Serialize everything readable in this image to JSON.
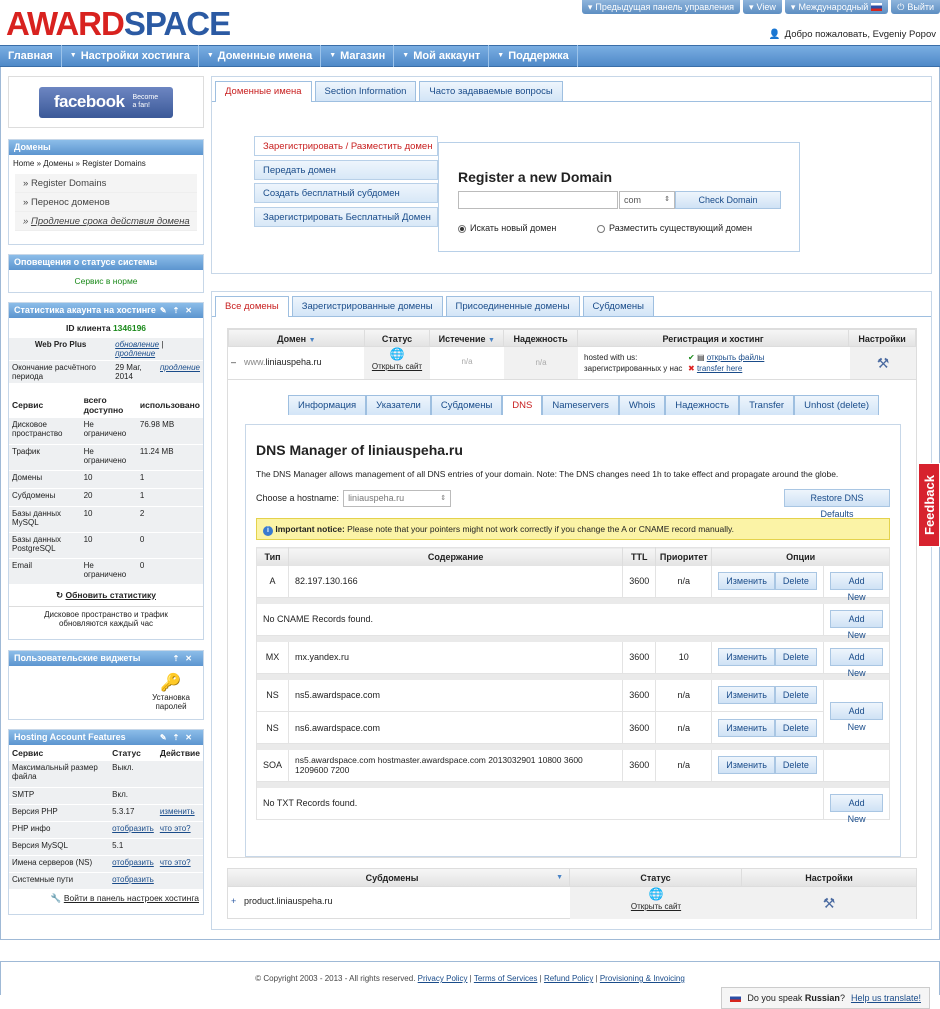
{
  "logo": {
    "part1": "AWARD",
    "part2": "SPACE"
  },
  "topbar": {
    "prev": "Предыдущая панель управления",
    "view": "View",
    "intl": "Международный",
    "logout": "Выйти"
  },
  "welcome": "Добро пожаловать, Evgeniy Popov",
  "nav": [
    "Главная",
    "Настройки хостинга",
    "Доменные имена",
    "Магазин",
    "Мой аккаунт",
    "Поддержка"
  ],
  "facebook": {
    "title": "facebook",
    "sub1": "Become",
    "sub2": "a fan!"
  },
  "domains_panel": {
    "title": "Домены",
    "crumb": "Home » Домены » Register Domains",
    "items": [
      "Register Domains",
      "Перенос доменов",
      "Продление срока действия домена"
    ]
  },
  "status_panel": {
    "title": "Оповещения о статусе системы",
    "text": "Сервис в норме"
  },
  "stats_panel": {
    "title": "Статистика акаунта на хостинге",
    "client_label": "ID клиента",
    "client_id": "1346196",
    "plan": "Web Pro Plus",
    "upgrade": "обновление",
    "extend": "продление",
    "expiry_label": "Окончание расчётного периода",
    "expiry_date": "29 Мaг, 2014",
    "extend2": "продление",
    "headers": [
      "Сервис",
      "всего доступно",
      "использовано"
    ],
    "rows": [
      [
        "Дисковое пространство",
        "Не ограничено",
        "76.98 MB"
      ],
      [
        "Трафик",
        "Не ограничено",
        "11.24 MB"
      ],
      [
        "Домены",
        "10",
        "1"
      ],
      [
        "Субдомены",
        "20",
        "1"
      ],
      [
        "Базы данных MySQL",
        "10",
        "2"
      ],
      [
        "Базы данных PostgreSQL",
        "10",
        "0"
      ],
      [
        "Email",
        "Не ограничено",
        "0"
      ]
    ],
    "refresh": "Обновить статистику",
    "note": "Дисковое пространство и трафик обновляются каждый час"
  },
  "widgets_panel": {
    "title": "Пользовательские виджеты",
    "item": "Установка паролей"
  },
  "features_panel": {
    "title": "Hosting Account Features",
    "headers": [
      "Сервис",
      "Статус",
      "Действие"
    ],
    "rows": [
      [
        "Максимальный размер файла",
        "Выкл.",
        ""
      ],
      [
        "SMTP",
        "Вкл.",
        ""
      ],
      [
        "Версия PHP",
        "5.3.17",
        "изменить"
      ],
      [
        "PHP инфо",
        "отобразить",
        "что это?"
      ],
      [
        "Версия MySQL",
        "5.1",
        ""
      ],
      [
        "Имена серверов (NS)",
        "отобразить",
        "что это?"
      ],
      [
        "Системные пути",
        "отобразить",
        ""
      ]
    ],
    "link": "Войти в панель настроек хостинга"
  },
  "top_tabs": [
    "Доменные имена",
    "Section Information",
    "Часто задаваемые вопросы"
  ],
  "reg_menu": [
    "Зарегистрировать / Разместить домен",
    "Передать домен",
    "Создать бесплатный субдомен",
    "Зарегистрировать Бесплатный Домен"
  ],
  "reg": {
    "title": "Register a new Domain",
    "tld": "com",
    "check": "Check Domain",
    "opt1": "Искать новый домен",
    "opt2": "Разместить существующий домен"
  },
  "dom_tabs": [
    "Все домены",
    "Зарегистрированные домены",
    "Присоединенные домены",
    "Субдомены"
  ],
  "dom_headers": [
    "Домен",
    "Статус",
    "Истечение",
    "Надежность",
    "Регистрация и хостинг",
    "Настройки"
  ],
  "domain": {
    "prefix": "www.",
    "name": "liniauspeha.ru",
    "open": "Открыть сайт",
    "exp": "n/a",
    "rel": "n/a",
    "hosted": "hosted with us:",
    "registered": "зарегистрированных у нас",
    "openfiles": "открыть файлы",
    "transfer": "transfer here"
  },
  "sub_tabs": [
    "Информация",
    "Указатели",
    "Субдомены",
    "DNS",
    "Nameservers",
    "Whois",
    "Надежность",
    "Transfer",
    "Unhost (delete)"
  ],
  "dns": {
    "title": "DNS Manager of liniauspeha.ru",
    "desc": "The DNS Manager allows management of all DNS entries of your domain. Note: The DNS changes need 1h to take effect and propagate around the globe.",
    "choose": "Choose a hostname:",
    "host": "liniauspeha.ru",
    "restore": "Restore DNS Defaults",
    "notice_b": "Important notice:",
    "notice": "Please note that your pointers might not work correctly if you change the A or CNAME record manually.",
    "headers": [
      "Тип",
      "Содержание",
      "TTL",
      "Приоритет",
      "Опции"
    ],
    "edit": "Изменить",
    "del": "Delete",
    "add": "Add New",
    "a": {
      "type": "A",
      "content": "82.197.130.166",
      "ttl": "3600",
      "prio": "n/a"
    },
    "cname": "No CNAME Records found.",
    "mx": {
      "type": "MX",
      "content": "mx.yandex.ru",
      "ttl": "3600",
      "prio": "10"
    },
    "ns1": {
      "type": "NS",
      "content": "ns5.awardspace.com",
      "ttl": "3600",
      "prio": "n/a"
    },
    "ns2": {
      "type": "NS",
      "content": "ns6.awardspace.com",
      "ttl": "3600",
      "prio": "n/a"
    },
    "soa": {
      "type": "SOA",
      "content": "ns5.awardspace.com hostmaster.awardspace.com 2013032901 10800 3600 1209600 7200",
      "ttl": "3600",
      "prio": "n/a"
    },
    "txt": "No TXT Records found."
  },
  "sub_headers": [
    "Субдомены",
    "Статус",
    "Настройки"
  ],
  "subdomain": {
    "name": "product.liniauspeha.ru",
    "open": "Открыть сайт"
  },
  "footer": {
    "copy": "© Copyright 2003 - 2013 - All rights reserved.",
    "links": [
      "Privacy Policy",
      "Terms of Services",
      "Refund Policy",
      "Provisioning & Invoicing"
    ]
  },
  "lang": {
    "q1": "Do you speak",
    "q2": "Russian",
    "q3": "?",
    "help": "Help us translate!"
  },
  "feedback": "Feedback"
}
